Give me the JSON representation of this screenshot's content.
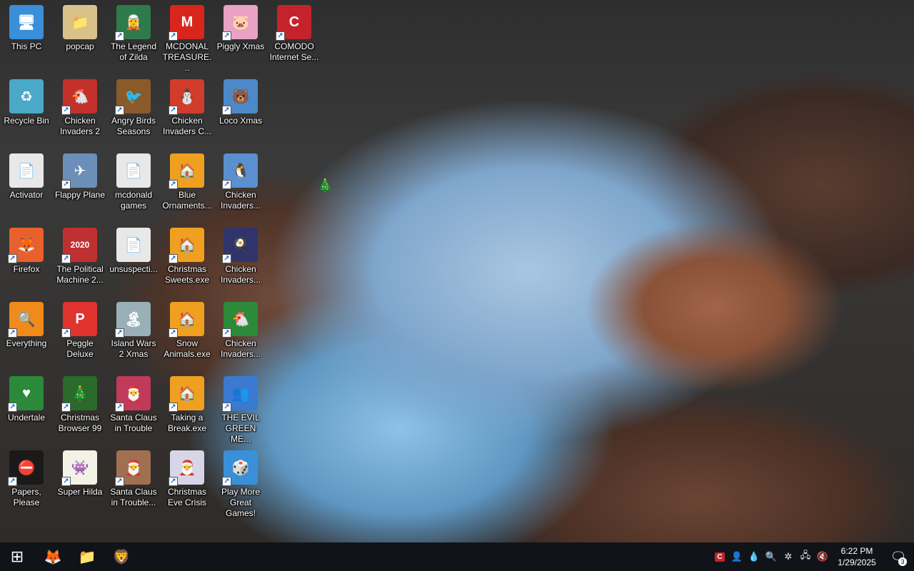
{
  "desktop": {
    "icons": [
      {
        "label": "This PC",
        "glyph": "🖥",
        "bg": "#3a8fd9",
        "shortcut": false
      },
      {
        "label": "popcap",
        "glyph": "📁",
        "bg": "#d9c28a",
        "shortcut": false
      },
      {
        "label": "The Legend of Zilda",
        "glyph": "🧝",
        "bg": "#2f7a4a",
        "shortcut": true
      },
      {
        "label": "MCDONAL TREASURE...",
        "glyph": "M",
        "bg": "#d8261c",
        "shortcut": true
      },
      {
        "label": "Piggly Xmas",
        "glyph": "🐷",
        "bg": "#e9a2c4",
        "shortcut": true
      },
      {
        "label": "COMODO Internet Se...",
        "glyph": "C",
        "bg": "#c5232b",
        "shortcut": true
      },
      {
        "label": "Recycle Bin",
        "glyph": "♻",
        "bg": "#4aa8c8",
        "shortcut": false
      },
      {
        "label": "Chicken Invaders 2",
        "glyph": "🐔",
        "bg": "#c4302b",
        "shortcut": true
      },
      {
        "label": "Angry Birds Seasons",
        "glyph": "🐦",
        "bg": "#8a5a2a",
        "shortcut": true
      },
      {
        "label": "Chicken Invaders C...",
        "glyph": "⛄",
        "bg": "#d23c2a",
        "shortcut": true
      },
      {
        "label": "Loco Xmas",
        "glyph": "🐻",
        "bg": "#4d89c9",
        "shortcut": true
      },
      {
        "label": "Activator",
        "glyph": "📄",
        "bg": "#e8e8e8",
        "shortcut": false
      },
      {
        "label": "Flappy Plane",
        "glyph": "✈",
        "bg": "#6b8fb8",
        "shortcut": true
      },
      {
        "label": "mcdonald games",
        "glyph": "📄",
        "bg": "#e8e8e8",
        "shortcut": false
      },
      {
        "label": "Blue Ornaments...",
        "glyph": "🏠",
        "bg": "#f0a020",
        "shortcut": true
      },
      {
        "label": "Chicken Invaders...",
        "glyph": "🐧",
        "bg": "#5a8fd0",
        "shortcut": true
      },
      {
        "label": "Firefox",
        "glyph": "🦊",
        "bg": "#e8602c",
        "shortcut": true
      },
      {
        "label": "The Political Machine 2...",
        "glyph": "2020",
        "bg": "#c03030",
        "shortcut": true
      },
      {
        "label": "unsuspecti...",
        "glyph": "📄",
        "bg": "#e8e8e8",
        "shortcut": false
      },
      {
        "label": "Christmas Sweets.exe",
        "glyph": "🏠",
        "bg": "#f0a020",
        "shortcut": true
      },
      {
        "label": "Chicken Invaders...",
        "glyph": "🍳",
        "bg": "#30346a",
        "shortcut": true
      },
      {
        "label": "Everything",
        "glyph": "🔍",
        "bg": "#f08a1a",
        "shortcut": true
      },
      {
        "label": "Peggle Deluxe",
        "glyph": "P",
        "bg": "#e0332d",
        "shortcut": true
      },
      {
        "label": "Island Wars 2 Xmas",
        "glyph": "🏝",
        "bg": "#9ab0b8",
        "shortcut": true
      },
      {
        "label": "Snow Animals.exe",
        "glyph": "🏠",
        "bg": "#f0a020",
        "shortcut": true
      },
      {
        "label": "Chicken Invaders...",
        "glyph": "🐔",
        "bg": "#2c8a38",
        "shortcut": true
      },
      {
        "label": "Undertale",
        "glyph": "♥",
        "bg": "#2a8a3a",
        "shortcut": true
      },
      {
        "label": "Christmas Browser 99",
        "glyph": "🎄",
        "bg": "#2a6a2a",
        "shortcut": true
      },
      {
        "label": "Santa Claus in Trouble",
        "glyph": "🎅",
        "bg": "#c23a5a",
        "shortcut": true
      },
      {
        "label": "Taking a Break.exe",
        "glyph": "🏠",
        "bg": "#f0a020",
        "shortcut": true
      },
      {
        "label": "THE EVIL GREEN ME...",
        "glyph": "👥",
        "bg": "#3a7ad0",
        "shortcut": true
      },
      {
        "label": "Papers, Please",
        "glyph": "⛔",
        "bg": "#1a1a1a",
        "shortcut": true
      },
      {
        "label": "Super Hilda",
        "glyph": "👾",
        "bg": "#f2f2e6",
        "shortcut": true
      },
      {
        "label": "Santa Claus in Trouble...",
        "glyph": "🎅",
        "bg": "#a07050",
        "shortcut": true
      },
      {
        "label": "Christmas Eve Crisis",
        "glyph": "🎅",
        "bg": "#d6d6e8",
        "shortcut": true
      },
      {
        "label": "Play More Great Games!",
        "glyph": "🎲",
        "bg": "#3a90d8",
        "shortcut": true
      }
    ],
    "extra": {
      "tree_glyph": "🎄"
    }
  },
  "taskbar": {
    "start_glyph": "⊞",
    "pinned": [
      {
        "name": "firefox",
        "glyph": "🦊"
      },
      {
        "name": "file-explorer",
        "glyph": "📁"
      },
      {
        "name": "brave",
        "glyph": "🦁"
      }
    ],
    "tray": [
      {
        "name": "comodo",
        "glyph": "C"
      },
      {
        "name": "network-users",
        "glyph": "👤"
      },
      {
        "name": "drop",
        "glyph": "💧"
      },
      {
        "name": "everything",
        "glyph": "🔍"
      },
      {
        "name": "snowflake",
        "glyph": "✲"
      },
      {
        "name": "network",
        "glyph": "🖧"
      },
      {
        "name": "volume-muted",
        "glyph": "🔇"
      }
    ],
    "time": "6:22 PM",
    "date": "1/29/2025",
    "notification_count": "3",
    "notification_glyph": "🗨"
  }
}
